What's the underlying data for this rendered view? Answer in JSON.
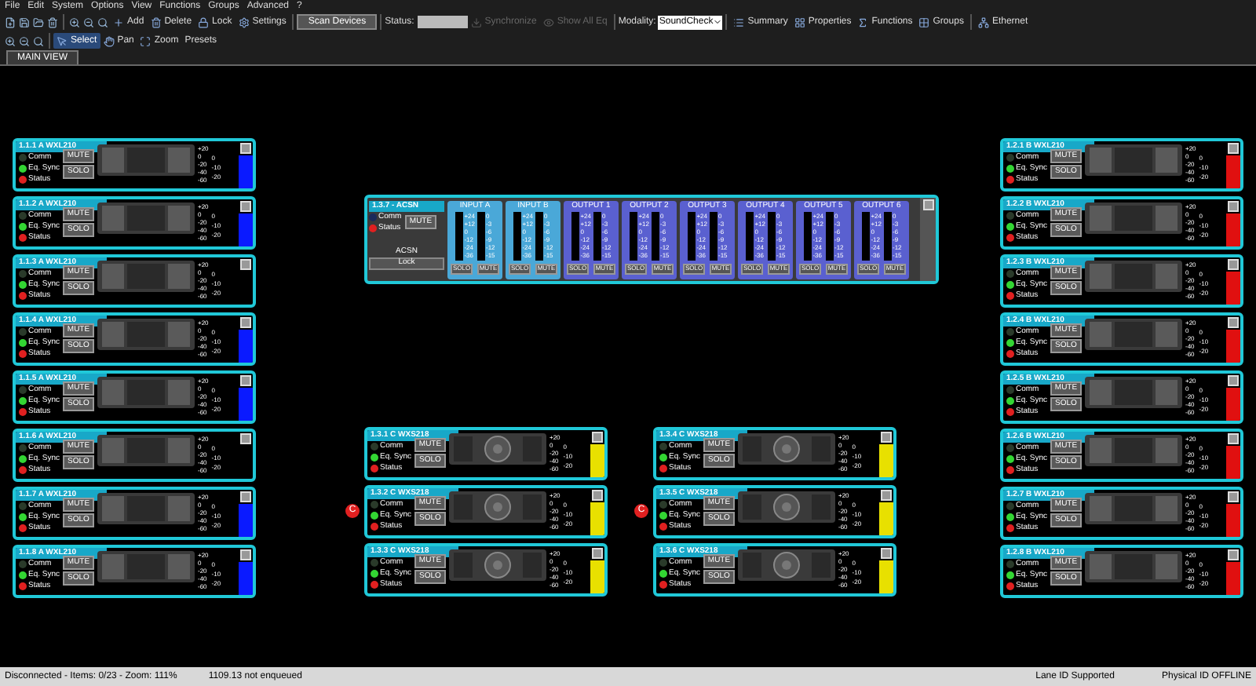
{
  "menu": [
    "File",
    "Edit",
    "System",
    "Options",
    "View",
    "Functions",
    "Groups",
    "Advanced",
    "?"
  ],
  "toolbar": {
    "edit_tools": [
      {
        "label": "Add"
      },
      {
        "label": "Delete"
      },
      {
        "label": "Lock"
      },
      {
        "label": "Settings"
      }
    ],
    "scan_button": "Scan Devices",
    "status_label": "Status:",
    "sync_buttons": [
      {
        "label": "Synchronize",
        "disabled": true
      },
      {
        "label": "Show All Eq",
        "disabled": true
      }
    ],
    "modality": {
      "label": "Modality:",
      "value": "SoundCheck"
    },
    "panels": [
      {
        "label": "Summary"
      },
      {
        "label": "Properties"
      },
      {
        "label": "Functions"
      },
      {
        "label": "Groups"
      }
    ],
    "network": "Ethernet",
    "view_tools": [
      {
        "label": "Select",
        "selected": true
      },
      {
        "label": "Pan",
        "selected": false
      },
      {
        "label": "Zoom",
        "selected": false
      }
    ],
    "presets": "Presets"
  },
  "tabs": [
    {
      "label": "MAIN VIEW",
      "selected": true
    }
  ],
  "left_devices": [
    {
      "name": "1.1.1 A WXL210",
      "kind": "line_array",
      "color": "#0a1aff",
      "leds": [
        {
          "label": "Comm",
          "color": "#2a3a2a"
        },
        {
          "label": "Eq. Sync",
          "color": "#33d633"
        },
        {
          "label": "Status",
          "color": "#e02020"
        }
      ],
      "mute": "MUTE",
      "solo": "SOLO",
      "scale_a": [
        "+20",
        "0",
        "-20",
        "-40",
        "-60"
      ],
      "scale_b": [
        "0",
        "-10",
        "-20"
      ]
    },
    {
      "name": "1.1.2 A WXL210",
      "kind": "line_array",
      "color": "#0a1aff",
      "leds": [
        {
          "label": "Comm",
          "color": "#2a3a2a"
        },
        {
          "label": "Eq. Sync",
          "color": "#33d633"
        },
        {
          "label": "Status",
          "color": "#e02020"
        }
      ],
      "mute": "MUTE",
      "solo": "SOLO",
      "scale_a": [
        "+20",
        "0",
        "-20",
        "-40",
        "-60"
      ],
      "scale_b": [
        "0",
        "-10",
        "-20"
      ]
    },
    {
      "name": "1.1.3 A WXL210",
      "kind": "line_array",
      "leds": [
        {
          "label": "Comm",
          "color": "#2a3a2a"
        },
        {
          "label": "Eq. Sync",
          "color": "#33d633"
        },
        {
          "label": "Status",
          "color": "#e02020"
        }
      ],
      "mute": "MUTE",
      "solo": "SOLO",
      "scale_a": [
        "+20",
        "0",
        "-20",
        "-40",
        "-60"
      ],
      "scale_b": [
        "0",
        "-10",
        "-20"
      ]
    },
    {
      "name": "1.1.4 A WXL210",
      "kind": "line_array",
      "color": "#0a1aff",
      "leds": [
        {
          "label": "Comm",
          "color": "#2a3a2a"
        },
        {
          "label": "Eq. Sync",
          "color": "#33d633"
        },
        {
          "label": "Status",
          "color": "#e02020"
        }
      ],
      "mute": "MUTE",
      "solo": "SOLO",
      "scale_a": [
        "+20",
        "0",
        "-20",
        "-40",
        "-60"
      ],
      "scale_b": [
        "0",
        "-10",
        "-20"
      ]
    },
    {
      "name": "1.1.5 A WXL210",
      "kind": "line_array",
      "color": "#0a1aff",
      "leds": [
        {
          "label": "Comm",
          "color": "#2a3a2a"
        },
        {
          "label": "Eq. Sync",
          "color": "#33d633"
        },
        {
          "label": "Status",
          "color": "#e02020"
        }
      ],
      "mute": "MUTE",
      "solo": "SOLO",
      "scale_a": [
        "+20",
        "0",
        "-20",
        "-40",
        "-60"
      ],
      "scale_b": [
        "0",
        "-10",
        "-20"
      ]
    },
    {
      "name": "1.1.6 A WXL210",
      "kind": "line_array",
      "leds": [
        {
          "label": "Comm",
          "color": "#2a3a2a"
        },
        {
          "label": "Eq. Sync",
          "color": "#33d633"
        },
        {
          "label": "Status",
          "color": "#e02020"
        }
      ],
      "mute": "MUTE",
      "solo": "SOLO",
      "scale_a": [
        "+20",
        "0",
        "-20",
        "-40",
        "-60"
      ],
      "scale_b": [
        "0",
        "-10",
        "-20"
      ]
    },
    {
      "name": "1.1.7 A WXL210",
      "kind": "line_array",
      "color": "#0a1aff",
      "leds": [
        {
          "label": "Comm",
          "color": "#2a3a2a"
        },
        {
          "label": "Eq. Sync",
          "color": "#33d633"
        },
        {
          "label": "Status",
          "color": "#e02020"
        }
      ],
      "mute": "MUTE",
      "solo": "SOLO",
      "scale_a": [
        "+20",
        "0",
        "-20",
        "-40",
        "-60"
      ],
      "scale_b": [
        "0",
        "-10",
        "-20"
      ]
    },
    {
      "name": "1.1.8 A WXL210",
      "kind": "line_array",
      "color": "#0a1aff",
      "leds": [
        {
          "label": "Comm",
          "color": "#2a3a2a"
        },
        {
          "label": "Eq. Sync",
          "color": "#33d633"
        },
        {
          "label": "Status",
          "color": "#e02020"
        }
      ],
      "mute": "MUTE",
      "solo": "SOLO",
      "scale_a": [
        "+20",
        "0",
        "-20",
        "-40",
        "-60"
      ],
      "scale_b": [
        "0",
        "-10",
        "-20"
      ]
    }
  ],
  "right_devices": [
    {
      "name": "1.2.1 B WXL210",
      "kind": "line_array",
      "color": "#e01010",
      "leds": [
        {
          "label": "Comm",
          "color": "#2a3a2a"
        },
        {
          "label": "Eq. Sync",
          "color": "#33d633"
        },
        {
          "label": "Status",
          "color": "#e02020"
        }
      ],
      "mute": "MUTE",
      "solo": "SOLO",
      "scale_a": [
        "+20",
        "0",
        "-20",
        "-40",
        "-60"
      ],
      "scale_b": [
        "0",
        "-10",
        "-20"
      ]
    },
    {
      "name": "1.2.2 B WXL210",
      "kind": "line_array",
      "color": "#e01010",
      "leds": [
        {
          "label": "Comm",
          "color": "#2a3a2a"
        },
        {
          "label": "Eq. Sync",
          "color": "#33d633"
        },
        {
          "label": "Status",
          "color": "#e02020"
        }
      ],
      "mute": "MUTE",
      "solo": "SOLO",
      "scale_a": [
        "+20",
        "0",
        "-20",
        "-40",
        "-60"
      ],
      "scale_b": [
        "0",
        "-10",
        "-20"
      ]
    },
    {
      "name": "1.2.3 B WXL210",
      "kind": "line_array",
      "color": "#e01010",
      "leds": [
        {
          "label": "Comm",
          "color": "#2a3a2a"
        },
        {
          "label": "Eq. Sync",
          "color": "#33d633"
        },
        {
          "label": "Status",
          "color": "#e02020"
        }
      ],
      "mute": "MUTE",
      "solo": "SOLO",
      "scale_a": [
        "+20",
        "0",
        "-20",
        "-40",
        "-60"
      ],
      "scale_b": [
        "0",
        "-10",
        "-20"
      ]
    },
    {
      "name": "1.2.4 B WXL210",
      "kind": "line_array",
      "color": "#e01010",
      "leds": [
        {
          "label": "Comm",
          "color": "#2a3a2a"
        },
        {
          "label": "Eq. Sync",
          "color": "#33d633"
        },
        {
          "label": "Status",
          "color": "#e02020"
        }
      ],
      "mute": "MUTE",
      "solo": "SOLO",
      "scale_a": [
        "+20",
        "0",
        "-20",
        "-40",
        "-60"
      ],
      "scale_b": [
        "0",
        "-10",
        "-20"
      ]
    },
    {
      "name": "1.2.5 B WXL210",
      "kind": "line_array",
      "color": "#e01010",
      "leds": [
        {
          "label": "Comm",
          "color": "#2a3a2a"
        },
        {
          "label": "Eq. Sync",
          "color": "#33d633"
        },
        {
          "label": "Status",
          "color": "#e02020"
        }
      ],
      "mute": "MUTE",
      "solo": "SOLO",
      "scale_a": [
        "+20",
        "0",
        "-20",
        "-40",
        "-60"
      ],
      "scale_b": [
        "0",
        "-10",
        "-20"
      ]
    },
    {
      "name": "1.2.6 B WXL210",
      "kind": "line_array",
      "color": "#e01010",
      "leds": [
        {
          "label": "Comm",
          "color": "#2a3a2a"
        },
        {
          "label": "Eq. Sync",
          "color": "#33d633"
        },
        {
          "label": "Status",
          "color": "#e02020"
        }
      ],
      "mute": "MUTE",
      "solo": "SOLO",
      "scale_a": [
        "+20",
        "0",
        "-20",
        "-40",
        "-60"
      ],
      "scale_b": [
        "0",
        "-10",
        "-20"
      ]
    },
    {
      "name": "1.2.7 B WXL210",
      "kind": "line_array",
      "color": "#e01010",
      "leds": [
        {
          "label": "Comm",
          "color": "#2a3a2a"
        },
        {
          "label": "Eq. Sync",
          "color": "#33d633"
        },
        {
          "label": "Status",
          "color": "#e02020"
        }
      ],
      "mute": "MUTE",
      "solo": "SOLO",
      "scale_a": [
        "+20",
        "0",
        "-20",
        "-40",
        "-60"
      ],
      "scale_b": [
        "0",
        "-10",
        "-20"
      ]
    },
    {
      "name": "1.2.8 B WXL210",
      "kind": "line_array",
      "color": "#e01010",
      "leds": [
        {
          "label": "Comm",
          "color": "#2a3a2a"
        },
        {
          "label": "Eq. Sync",
          "color": "#33d633"
        },
        {
          "label": "Status",
          "color": "#e02020"
        }
      ],
      "mute": "MUTE",
      "solo": "SOLO",
      "scale_a": [
        "+20",
        "0",
        "-20",
        "-40",
        "-60"
      ],
      "scale_b": [
        "0",
        "-10",
        "-20"
      ]
    }
  ],
  "center_devices": [
    {
      "name": "1.3.1 C WXS218",
      "kind": "subwoofer",
      "color": "#e8e000",
      "leds": [
        {
          "label": "Comm",
          "color": "#2a3a2a"
        },
        {
          "label": "Eq. Sync",
          "color": "#33d633"
        },
        {
          "label": "Status",
          "color": "#e02020"
        }
      ],
      "mute": "MUTE",
      "solo": "SOLO",
      "scale_a": [
        "+20",
        "0",
        "-20",
        "-40",
        "-60"
      ],
      "scale_b": [
        "0",
        "-10",
        "-20"
      ]
    },
    {
      "name": "1.3.4 C WXS218",
      "kind": "subwoofer",
      "color": "#e8e000",
      "leds": [
        {
          "label": "Comm",
          "color": "#2a3a2a"
        },
        {
          "label": "Eq. Sync",
          "color": "#33d633"
        },
        {
          "label": "Status",
          "color": "#e02020"
        }
      ],
      "mute": "MUTE",
      "solo": "SOLO",
      "scale_a": [
        "+20",
        "0",
        "-20",
        "-40",
        "-60"
      ],
      "scale_b": [
        "0",
        "-10",
        "-20"
      ]
    },
    {
      "name": "1.3.2 C WXS218",
      "kind": "subwoofer",
      "color": "#e8e000",
      "badge": "C",
      "leds": [
        {
          "label": "Comm",
          "color": "#2a3a2a"
        },
        {
          "label": "Eq. Sync",
          "color": "#33d633"
        },
        {
          "label": "Status",
          "color": "#e02020"
        }
      ],
      "mute": "MUTE",
      "solo": "SOLO",
      "scale_a": [
        "+20",
        "0",
        "-20",
        "-40",
        "-60"
      ],
      "scale_b": [
        "0",
        "-10",
        "-20"
      ]
    },
    {
      "name": "1.3.5 C WXS218",
      "kind": "subwoofer",
      "color": "#e8e000",
      "badge": "C",
      "leds": [
        {
          "label": "Comm",
          "color": "#2a3a2a"
        },
        {
          "label": "Eq. Sync",
          "color": "#33d633"
        },
        {
          "label": "Status",
          "color": "#e02020"
        }
      ],
      "mute": "MUTE",
      "solo": "SOLO",
      "scale_a": [
        "+20",
        "0",
        "-20",
        "-40",
        "-60"
      ],
      "scale_b": [
        "0",
        "-10",
        "-20"
      ]
    },
    {
      "name": "1.3.3 C WXS218",
      "kind": "subwoofer",
      "color": "#e8e000",
      "leds": [
        {
          "label": "Comm",
          "color": "#2a3a2a"
        },
        {
          "label": "Eq. Sync",
          "color": "#33d633"
        },
        {
          "label": "Status",
          "color": "#e02020"
        }
      ],
      "mute": "MUTE",
      "solo": "SOLO",
      "scale_a": [
        "+20",
        "0",
        "-20",
        "-40",
        "-60"
      ],
      "scale_b": [
        "0",
        "-10",
        "-20"
      ]
    },
    {
      "name": "1.3.6 C WXS218",
      "kind": "subwoofer",
      "color": "#e8e000",
      "leds": [
        {
          "label": "Comm",
          "color": "#2a3a2a"
        },
        {
          "label": "Eq. Sync",
          "color": "#33d633"
        },
        {
          "label": "Status",
          "color": "#e02020"
        }
      ],
      "mute": "MUTE",
      "solo": "SOLO",
      "scale_a": [
        "+20",
        "0",
        "-20",
        "-40",
        "-60"
      ],
      "scale_b": [
        "0",
        "-10",
        "-20"
      ]
    }
  ],
  "processor": {
    "name": "1.3.7 - ACSN",
    "leds": [
      {
        "label": "Comm",
        "color": "#1a2a5a"
      },
      {
        "label": "Status",
        "color": "#e02020"
      }
    ],
    "mute": "MUTE",
    "model": "ACSN",
    "lock": "Lock",
    "channels": [
      {
        "label": "INPUT A",
        "kind": "input",
        "solo": "SOLO",
        "mute": "MUTE",
        "scale_a": [
          "+24",
          "+12",
          "0",
          "-12",
          "-24",
          "-36"
        ],
        "scale_b": [
          "0",
          "-3",
          "-6",
          "-9",
          "-12",
          "-15"
        ]
      },
      {
        "label": "INPUT B",
        "kind": "input",
        "solo": "SOLO",
        "mute": "MUTE",
        "scale_a": [
          "+24",
          "+12",
          "0",
          "-12",
          "-24",
          "-36"
        ],
        "scale_b": [
          "0",
          "-3",
          "-6",
          "-9",
          "-12",
          "-15"
        ]
      },
      {
        "label": "OUTPUT 1",
        "kind": "output",
        "solo": "SOLO",
        "mute": "MUTE",
        "scale_a": [
          "+24",
          "+12",
          "0",
          "-12",
          "-24",
          "-36"
        ],
        "scale_b": [
          "0",
          "-3",
          "-6",
          "-9",
          "-12",
          "-15"
        ]
      },
      {
        "label": "OUTPUT 2",
        "kind": "output",
        "solo": "SOLO",
        "mute": "MUTE",
        "scale_a": [
          "+24",
          "+12",
          "0",
          "-12",
          "-24",
          "-36"
        ],
        "scale_b": [
          "0",
          "-3",
          "-6",
          "-9",
          "-12",
          "-15"
        ]
      },
      {
        "label": "OUTPUT 3",
        "kind": "output",
        "solo": "SOLO",
        "mute": "MUTE",
        "scale_a": [
          "+24",
          "+12",
          "0",
          "-12",
          "-24",
          "-36"
        ],
        "scale_b": [
          "0",
          "-3",
          "-6",
          "-9",
          "-12",
          "-15"
        ]
      },
      {
        "label": "OUTPUT 4",
        "kind": "output",
        "solo": "SOLO",
        "mute": "MUTE",
        "scale_a": [
          "+24",
          "+12",
          "0",
          "-12",
          "-24",
          "-36"
        ],
        "scale_b": [
          "0",
          "-3",
          "-6",
          "-9",
          "-12",
          "-15"
        ]
      },
      {
        "label": "OUTPUT 5",
        "kind": "output",
        "solo": "SOLO",
        "mute": "MUTE",
        "scale_a": [
          "+24",
          "+12",
          "0",
          "-12",
          "-24",
          "-36"
        ],
        "scale_b": [
          "0",
          "-3",
          "-6",
          "-9",
          "-12",
          "-15"
        ]
      },
      {
        "label": "OUTPUT 6",
        "kind": "output",
        "solo": "SOLO",
        "mute": "MUTE",
        "scale_a": [
          "+24",
          "+12",
          "0",
          "-12",
          "-24",
          "-36"
        ],
        "scale_b": [
          "0",
          "-3",
          "-6",
          "-9",
          "-12",
          "-15"
        ]
      }
    ]
  },
  "status_bar": {
    "left": "Disconnected - Items: 0/23 - Zoom: 111%",
    "middle": "1109.13 not enqueued",
    "right": [
      "Lane ID Supported",
      "Physical ID OFFLINE"
    ]
  }
}
